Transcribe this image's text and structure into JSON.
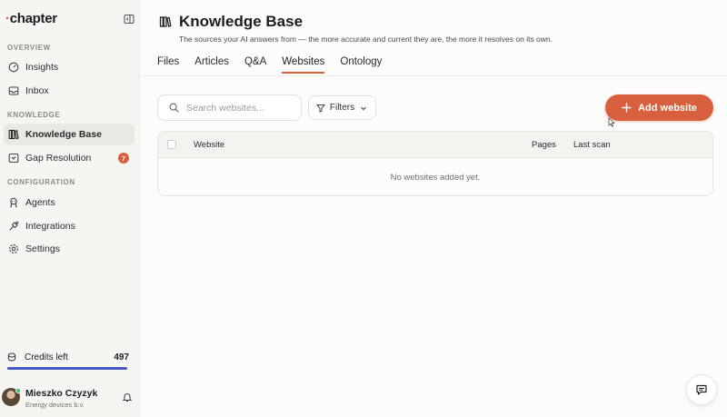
{
  "app": {
    "logo_prefix": "·",
    "logo_name": "chapter"
  },
  "sidebar": {
    "sections": {
      "overview": "OVERVIEW",
      "knowledge": "KNOWLEDGE",
      "configuration": "CONFIGURATION"
    },
    "items": [
      {
        "label": "Insights",
        "icon": "gauge-icon"
      },
      {
        "label": "Inbox",
        "icon": "inbox-icon"
      },
      {
        "label": "Knowledge Base",
        "icon": "books-icon",
        "active": true
      },
      {
        "label": "Gap Resolution",
        "icon": "wrench-icon",
        "badge": "7"
      },
      {
        "label": "Agents",
        "icon": "robot-icon"
      },
      {
        "label": "Integrations",
        "icon": "plug-icon"
      },
      {
        "label": "Settings",
        "icon": "gear-icon"
      }
    ],
    "credits": {
      "label": "Credits left",
      "value": "497",
      "fill_fraction": 1.0
    },
    "user": {
      "name": "Mieszko Czyzyk",
      "org": "Energy devices b.v.",
      "status": "online"
    }
  },
  "page": {
    "title": "Knowledge Base",
    "subtitle": "The sources your AI answers from — the more accurate and current they are, the more it resolves on its own."
  },
  "tabs": [
    "Files",
    "Articles",
    "Q&A",
    "Websites",
    "Ontology"
  ],
  "active_tab": "Websites",
  "toolbar": {
    "search_placeholder": "Search websites...",
    "filters_label": "Filters",
    "add_label": "Add website"
  },
  "table": {
    "columns": [
      "Website",
      "Pages",
      "Last scan"
    ],
    "empty_message": "No websites added yet."
  },
  "colors": {
    "accent": "#d9603e",
    "credits_bar": "#4658c8",
    "online": "#3ec06b"
  }
}
